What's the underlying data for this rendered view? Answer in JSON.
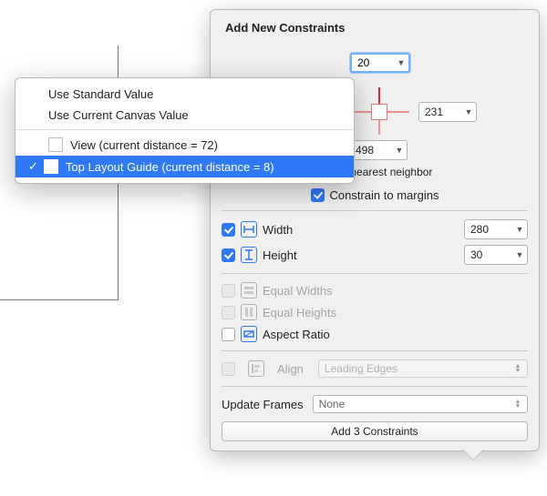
{
  "title": "Add New Constraints",
  "pin": {
    "top": "20",
    "right": "231",
    "bottom": "498",
    "neighbor_text": "g to nearest neighbor",
    "constrain_margins": "Constrain to margins"
  },
  "dims": {
    "width_label": "Width",
    "width_value": "280",
    "height_label": "Height",
    "height_value": "30"
  },
  "opts": {
    "equal_widths": "Equal Widths",
    "equal_heights": "Equal Heights",
    "aspect_ratio": "Aspect Ratio",
    "align_label": "Align",
    "align_value": "Leading Edges"
  },
  "update": {
    "label": "Update Frames",
    "value": "None"
  },
  "add_button": "Add 3 Constraints",
  "menu": {
    "use_standard": "Use Standard Value",
    "use_current_canvas": "Use Current Canvas Value",
    "view_item": "View (current distance = 72)",
    "top_layout": "Top Layout Guide (current distance = 8)"
  }
}
